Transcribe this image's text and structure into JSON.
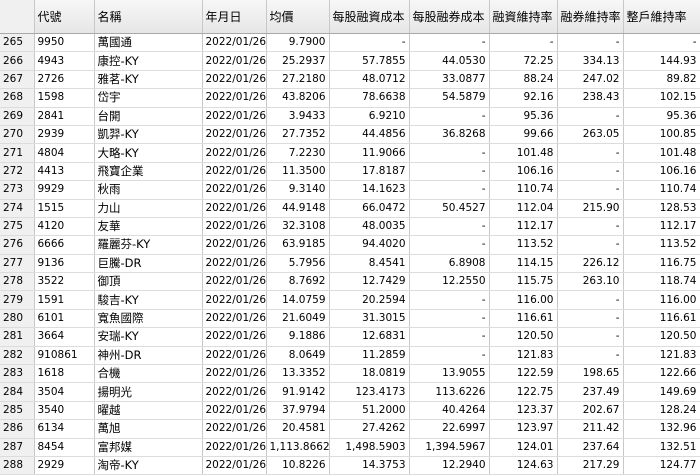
{
  "headers": [
    "",
    "代號",
    "名稱",
    "年月日",
    "均價",
    "每股融資成本",
    "每股融券成本",
    "融資維持率",
    "融券維持率",
    "整戶維持率"
  ],
  "rows": [
    [
      "265",
      "9950",
      "萬國通",
      "2022/01/26",
      "9.7900",
      "-",
      "-",
      "-",
      "-",
      "-"
    ],
    [
      "266",
      "4943",
      "康控-KY",
      "2022/01/26",
      "25.2937",
      "57.7855",
      "44.0530",
      "72.25",
      "334.13",
      "144.93"
    ],
    [
      "267",
      "2726",
      "雅茗-KY",
      "2022/01/26",
      "27.2180",
      "48.0712",
      "33.0877",
      "88.24",
      "247.02",
      "89.82"
    ],
    [
      "268",
      "1598",
      "岱宇",
      "2022/01/26",
      "43.8206",
      "78.6638",
      "54.5879",
      "92.16",
      "238.43",
      "102.15"
    ],
    [
      "269",
      "2841",
      "台開",
      "2022/01/26",
      "3.9433",
      "6.9210",
      "-",
      "95.36",
      "-",
      "95.36"
    ],
    [
      "270",
      "2939",
      "凱羿-KY",
      "2022/01/26",
      "27.7352",
      "44.4856",
      "36.8268",
      "99.66",
      "263.05",
      "100.85"
    ],
    [
      "271",
      "4804",
      "大略-KY",
      "2022/01/26",
      "7.2230",
      "11.9066",
      "-",
      "101.48",
      "-",
      "101.48"
    ],
    [
      "272",
      "4413",
      "飛寶企業",
      "2022/01/26",
      "11.3500",
      "17.8187",
      "-",
      "106.16",
      "-",
      "106.16"
    ],
    [
      "273",
      "9929",
      "秋雨",
      "2022/01/26",
      "9.3140",
      "14.1623",
      "-",
      "110.74",
      "-",
      "110.74"
    ],
    [
      "274",
      "1515",
      "力山",
      "2022/01/26",
      "44.9148",
      "66.0472",
      "50.4527",
      "112.04",
      "215.90",
      "128.53"
    ],
    [
      "275",
      "4120",
      "友華",
      "2022/01/26",
      "32.3108",
      "48.0035",
      "-",
      "112.17",
      "-",
      "112.17"
    ],
    [
      "276",
      "6666",
      "羅麗芬-KY",
      "2022/01/26",
      "63.9185",
      "94.4020",
      "-",
      "113.52",
      "-",
      "113.52"
    ],
    [
      "277",
      "9136",
      "巨騰-DR",
      "2022/01/26",
      "5.7956",
      "8.4541",
      "6.8908",
      "114.15",
      "226.12",
      "116.75"
    ],
    [
      "278",
      "3522",
      "御頂",
      "2022/01/26",
      "8.7692",
      "12.7429",
      "12.2550",
      "115.75",
      "263.10",
      "118.74"
    ],
    [
      "279",
      "1591",
      "駿吉-KY",
      "2022/01/26",
      "14.0759",
      "20.2594",
      "-",
      "116.00",
      "-",
      "116.00"
    ],
    [
      "280",
      "6101",
      "寬魚國際",
      "2022/01/26",
      "21.6049",
      "31.3015",
      "-",
      "116.61",
      "-",
      "116.61"
    ],
    [
      "281",
      "3664",
      "安瑞-KY",
      "2022/01/26",
      "9.1886",
      "12.6831",
      "-",
      "120.50",
      "-",
      "120.50"
    ],
    [
      "282",
      "910861",
      "神州-DR",
      "2022/01/26",
      "8.0649",
      "11.2859",
      "-",
      "121.83",
      "-",
      "121.83"
    ],
    [
      "283",
      "1618",
      "合機",
      "2022/01/26",
      "13.3352",
      "18.0819",
      "13.9055",
      "122.59",
      "198.65",
      "122.66"
    ],
    [
      "284",
      "3504",
      "揚明光",
      "2022/01/26",
      "91.9142",
      "123.4173",
      "113.6226",
      "122.75",
      "237.49",
      "149.69"
    ],
    [
      "285",
      "3540",
      "曜越",
      "2022/01/26",
      "37.9794",
      "51.2000",
      "40.4264",
      "123.37",
      "202.67",
      "128.24"
    ],
    [
      "286",
      "6134",
      "萬旭",
      "2022/01/26",
      "20.4581",
      "27.4262",
      "22.6997",
      "123.97",
      "211.42",
      "132.96"
    ],
    [
      "287",
      "8454",
      "富邦媒",
      "2022/01/26",
      "1,113.8662",
      "1,498.5903",
      "1,394.5967",
      "124.01",
      "237.64",
      "132.51"
    ],
    [
      "288",
      "2929",
      "淘帝-KY",
      "2022/01/26",
      "10.8226",
      "14.3753",
      "12.2940",
      "124.63",
      "217.29",
      "124.77"
    ]
  ]
}
